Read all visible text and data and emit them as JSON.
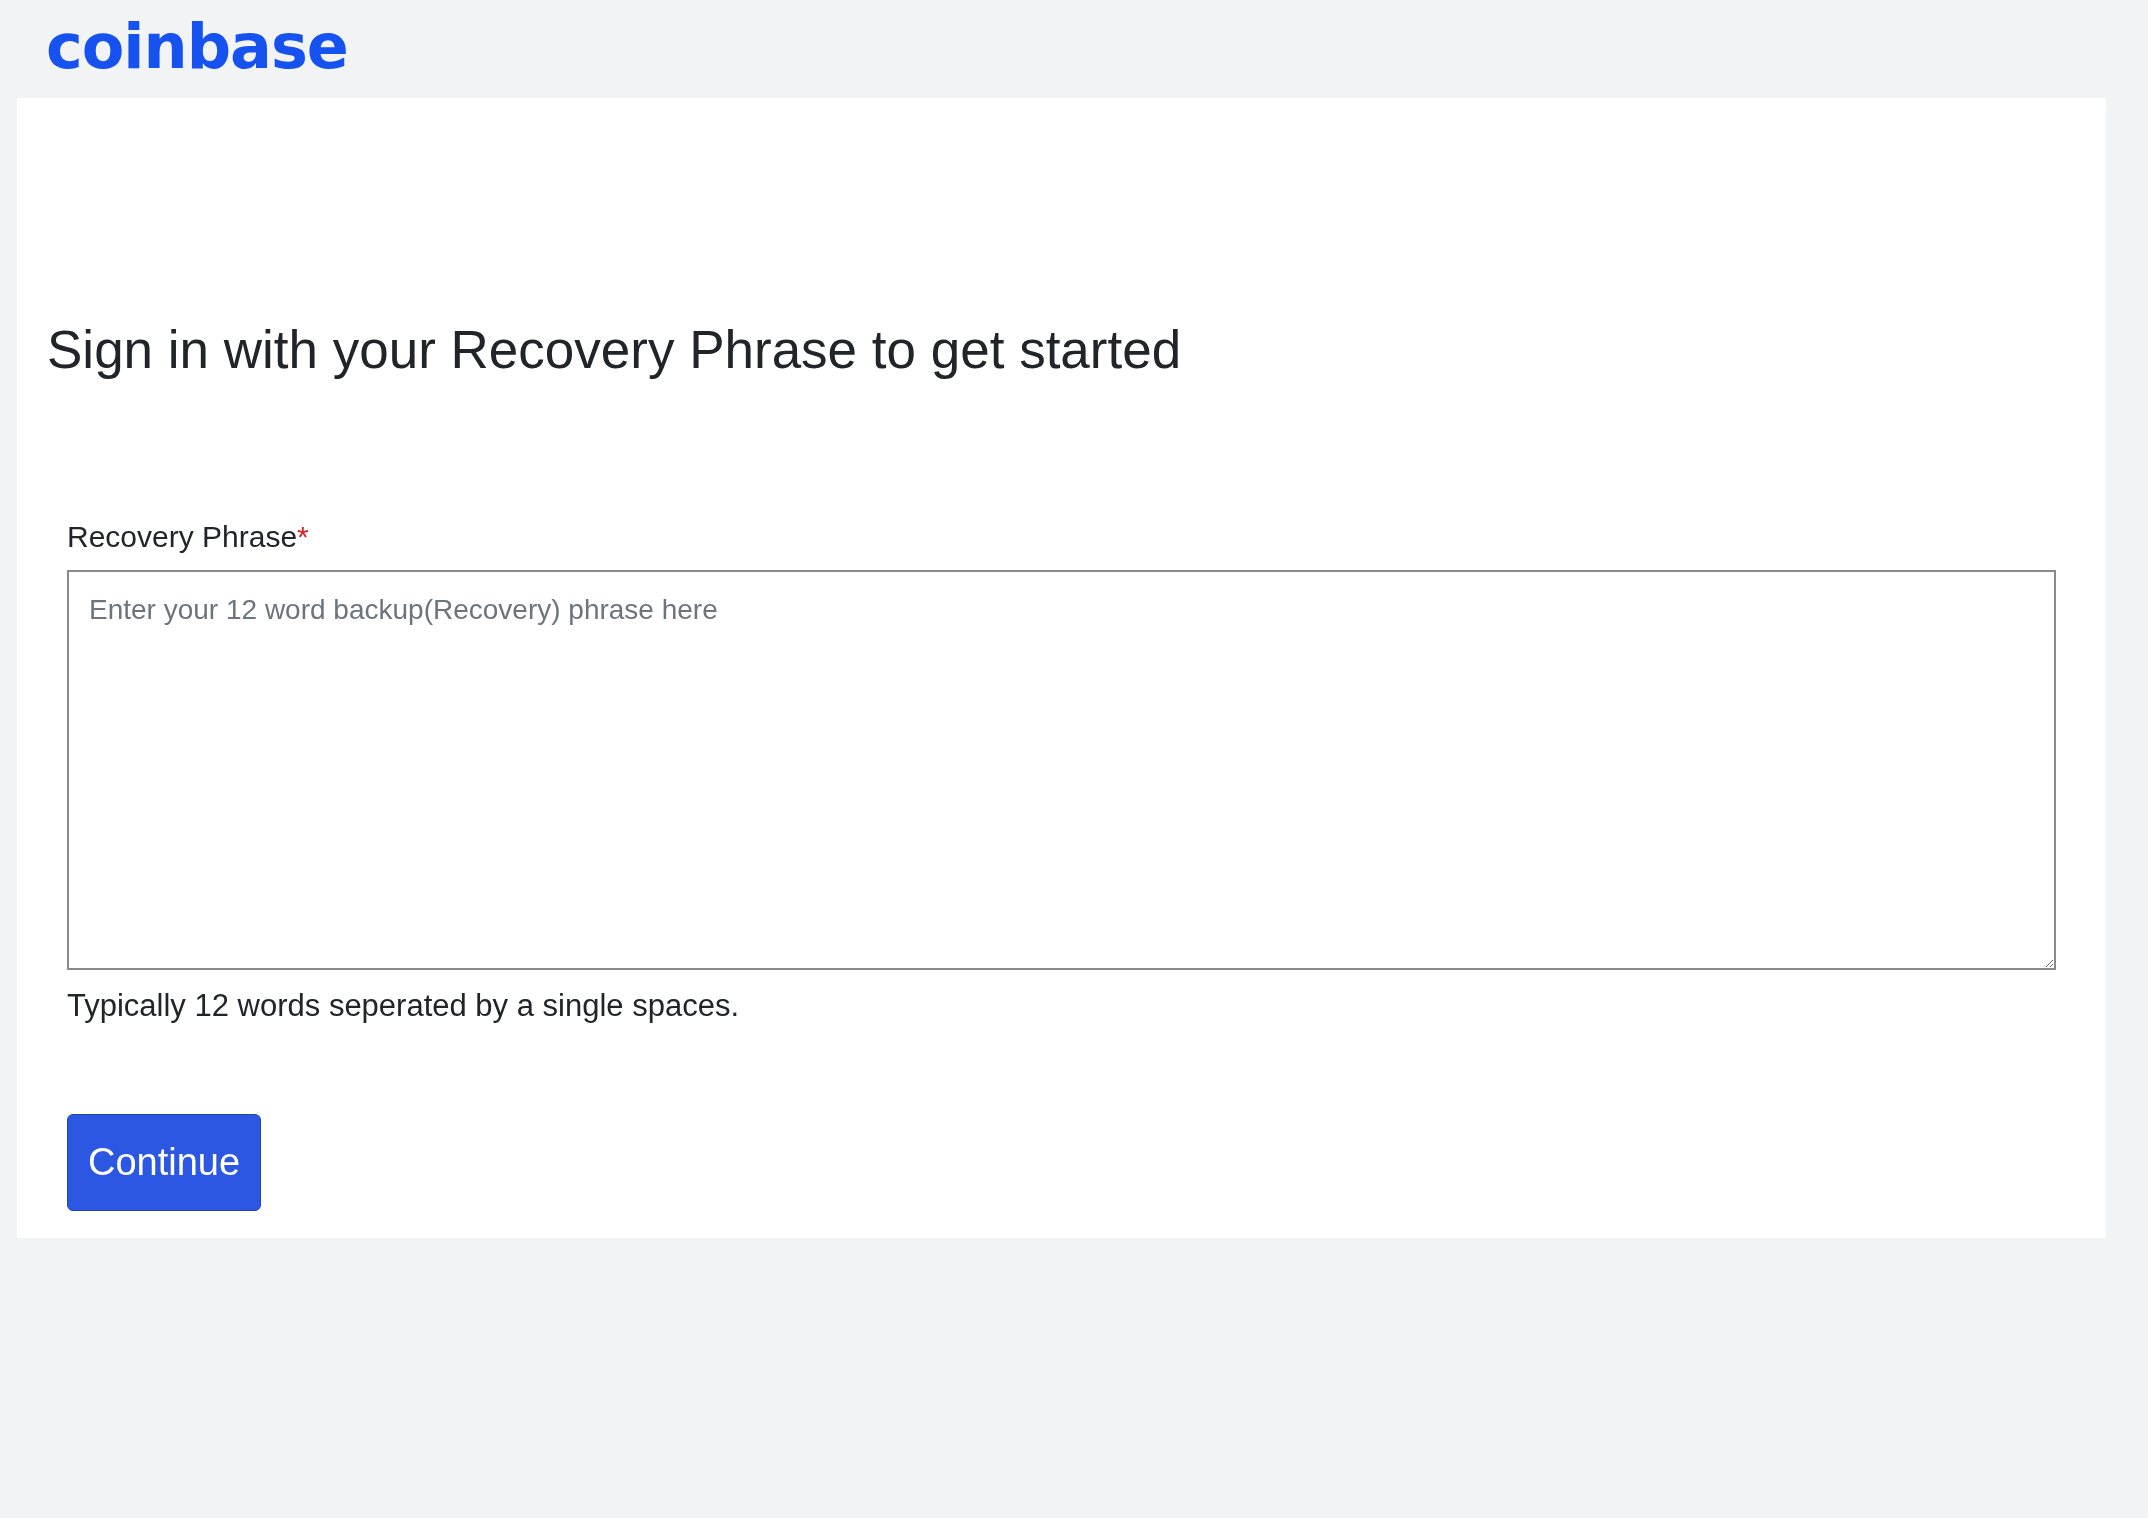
{
  "logo": {
    "text": "coinbase"
  },
  "heading": "Sign in with your Recovery Phrase to get started",
  "field": {
    "label": "Recovery Phrase",
    "required_mark": "*",
    "placeholder": "Enter your 12 word backup(Recovery) phrase here",
    "help": "Typically 12 words seperated by a single spaces."
  },
  "buttons": [
    {
      "label": "Continue"
    }
  ]
}
